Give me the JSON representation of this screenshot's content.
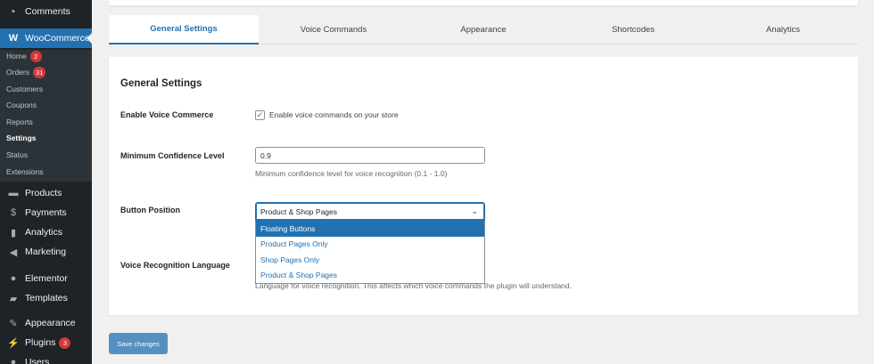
{
  "sidebar": {
    "comments": "Comments",
    "woocommerce": "WooCommerce",
    "sub": [
      {
        "label": "Home",
        "badge": "2"
      },
      {
        "label": "Orders",
        "badge": "31"
      },
      {
        "label": "Customers"
      },
      {
        "label": "Coupons"
      },
      {
        "label": "Reports"
      },
      {
        "label": "Settings"
      },
      {
        "label": "Status"
      },
      {
        "label": "Extensions"
      }
    ],
    "products": "Products",
    "payments": "Payments",
    "analytics": "Analytics",
    "marketing": "Marketing",
    "elementor": "Elementor",
    "templates": "Templates",
    "appearance": "Appearance",
    "plugins": "Plugins",
    "plugins_badge": "3",
    "users": "Users"
  },
  "tabs": [
    "General Settings",
    "Voice Commands",
    "Appearance",
    "Shortcodes",
    "Analytics"
  ],
  "form": {
    "section_title": "General Settings",
    "enable_label": "Enable Voice Commerce",
    "enable_checkbox_label": "Enable voice commands on your store",
    "enable_checked": true,
    "confidence_label": "Minimum Confidence Level",
    "confidence_value": "0.9",
    "confidence_desc": "Minimum confidence level for voice recognition (0.1 - 1.0)",
    "position_label": "Button Position",
    "position_value": "Product & Shop Pages",
    "position_options": [
      "Floating Buttons",
      "Product Pages Only",
      "Shop Pages Only",
      "Product & Shop Pages"
    ],
    "position_highlighted": "Floating Buttons",
    "language_label": "Voice Recognition Language",
    "language_desc": "Language for voice recognition. This affects which voice commands the plugin will understand."
  },
  "save_button": "Save changes",
  "colors": {
    "accent": "#2271b1",
    "sidebar": "#1d2327",
    "badge": "#d63638"
  }
}
